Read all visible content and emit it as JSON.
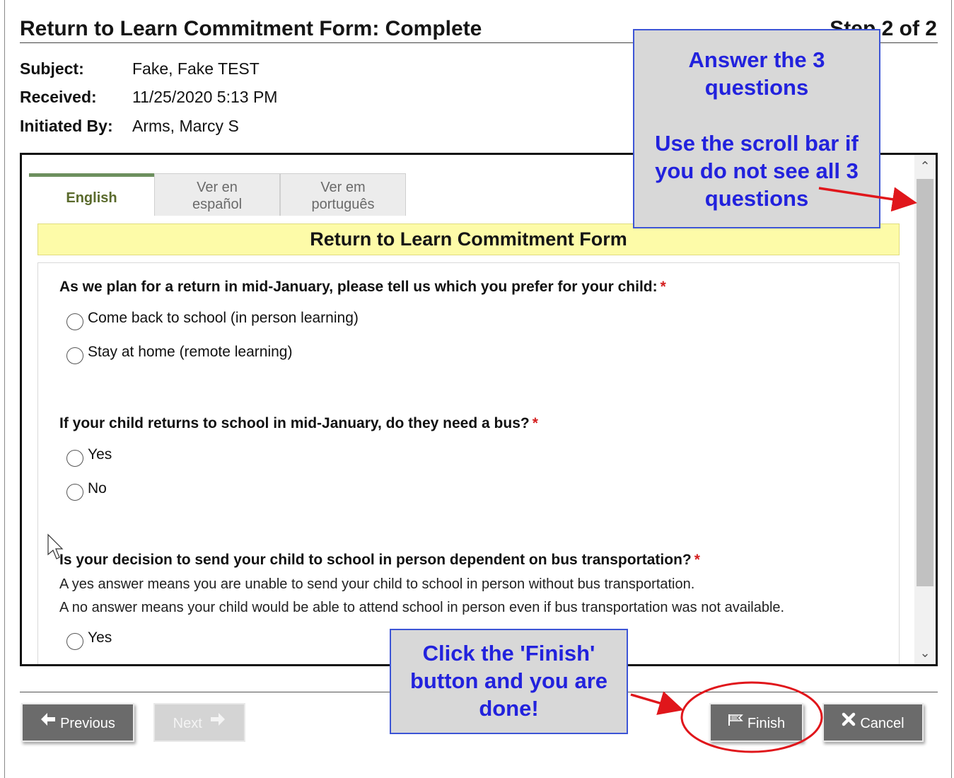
{
  "page": {
    "title": "Return to Learn Commitment Form: Complete",
    "step": "Step 2 of 2"
  },
  "meta": [
    {
      "label": "Subject:",
      "value": "Fake, Fake TEST"
    },
    {
      "label": "Received:",
      "value": "11/25/2020 5:13 PM"
    },
    {
      "label": "Initiated By:",
      "value": "Arms, Marcy S"
    }
  ],
  "tabs": {
    "english": "English",
    "spanish": [
      "Ver en",
      "español"
    ],
    "portuguese": [
      "Ver em",
      "português"
    ]
  },
  "form": {
    "header": "Return to Learn Commitment Form",
    "required_marker": "*",
    "questions": [
      {
        "text": "As we plan for a return in mid-January, please tell us which you prefer for your child:",
        "options": [
          "Come back to school (in person learning)",
          "Stay at home (remote learning)"
        ]
      },
      {
        "text": "If your child returns to school in mid-January, do they need a bus?",
        "options": [
          "Yes",
          "No"
        ]
      },
      {
        "text": "Is your decision to send your child to school in person dependent on bus transportation?",
        "help": [
          "A yes answer means you are unable to send your child to school in person without bus transportation.",
          "A no answer means your child would be able to attend school in person even if bus transportation was not available."
        ],
        "options": [
          "Yes"
        ]
      }
    ]
  },
  "buttons": {
    "previous": "Previous",
    "next": "Next",
    "finish": "Finish",
    "cancel": "Cancel"
  },
  "annotations": {
    "top_callout": [
      "Answer the 3",
      "questions",
      "Use the scroll bar if",
      "you do not see all 3",
      "questions"
    ],
    "bottom_callout": [
      "Click the 'Finish'",
      "button and you are",
      "done!"
    ]
  },
  "colors": {
    "callout_text": "#2222dd",
    "callout_border": "#3d55d6",
    "annotation_red": "#e0161b",
    "form_header_bg": "#fdfba8",
    "required": "#d42020",
    "button_bg": "#6b6b6b",
    "active_tab_accent": "#6c8f5e"
  },
  "icons": {
    "previous": "arrow-left-icon",
    "next": "arrow-right-icon",
    "finish": "flag-icon",
    "cancel": "close-icon",
    "scroll_up": "chevron-up-icon",
    "scroll_down": "chevron-down-icon"
  }
}
